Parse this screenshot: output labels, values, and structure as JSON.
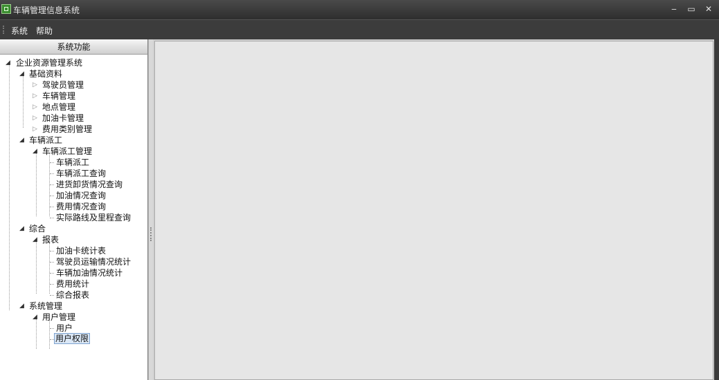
{
  "window": {
    "title": "车辆管理信息系统",
    "controls": {
      "minimize": "‒",
      "maximize": "▭",
      "close": "✕"
    }
  },
  "menu": [
    {
      "label": "系统"
    },
    {
      "label": "帮助"
    }
  ],
  "sidebar": {
    "title": "系统功能",
    "tree": {
      "root": "企业资源管理系统",
      "groups": [
        {
          "label": "基础资料",
          "children": [
            "驾驶员管理",
            "车辆管理",
            "地点管理",
            "加油卡管理",
            "费用类别管理"
          ]
        },
        {
          "label": "车辆派工",
          "sub": "车辆派工管理",
          "items": [
            "车辆派工",
            "车辆派工查询",
            "进货卸货情况查询",
            "加油情况查询",
            "费用情况查询",
            "实际路线及里程查询"
          ]
        },
        {
          "label": "综合",
          "sub": "报表",
          "items": [
            "加油卡统计表",
            "驾驶员运输情况统计",
            "车辆加油情况统计",
            "费用统计",
            "综合报表"
          ]
        },
        {
          "label": "系统管理",
          "sub": "用户管理",
          "items": [
            "用户",
            "用户权限"
          ]
        }
      ],
      "selected": "用户权限"
    }
  }
}
